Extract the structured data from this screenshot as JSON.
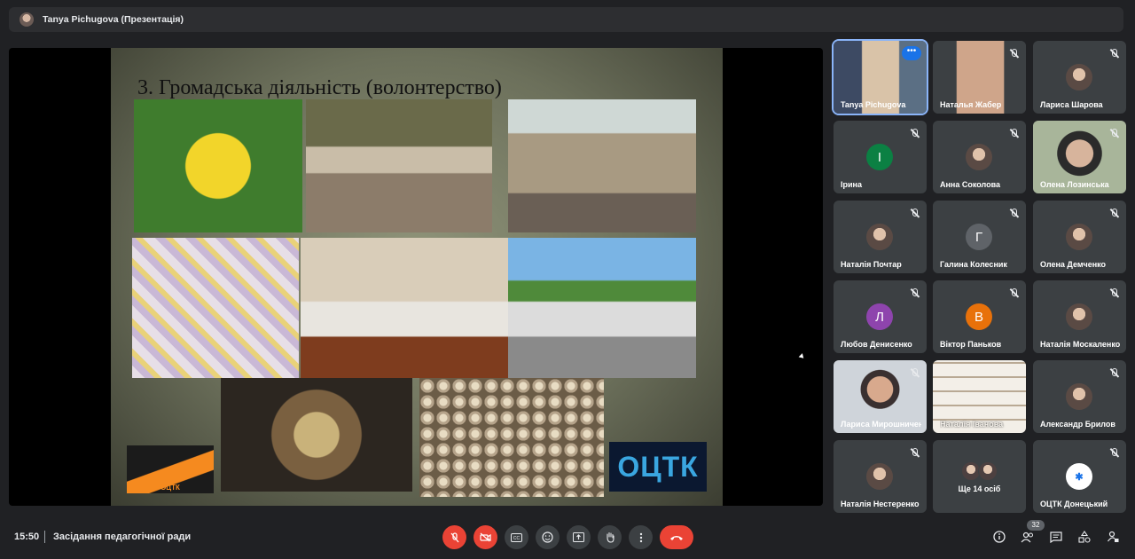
{
  "topbar": {
    "title": "Tanya Pichugova (Презентація)"
  },
  "slide": {
    "title": "3. Громадська діяльність (волонтерство)",
    "logo_left_text": "ОЦТК",
    "logo_right_text": "ОЦТК"
  },
  "participants": [
    {
      "name": "Tanya Pichugova",
      "type": "video"
    },
    {
      "name": "Наталья Жабер",
      "type": "video"
    },
    {
      "name": "Лариса Шарова",
      "type": "photo"
    },
    {
      "name": "Ірина",
      "type": "letter",
      "letter": "І",
      "color": "#0b8043"
    },
    {
      "name": "Анна Соколова",
      "type": "photo"
    },
    {
      "name": "Олена Лозинська",
      "type": "video"
    },
    {
      "name": "Наталія Почтар",
      "type": "photo"
    },
    {
      "name": "Галина Колесник",
      "type": "letter",
      "letter": "Г",
      "color": "#5f6368"
    },
    {
      "name": "Олена Демченко",
      "type": "photo"
    },
    {
      "name": "Любов Денисенко",
      "type": "letter",
      "letter": "Л",
      "color": "#8e44ad"
    },
    {
      "name": "Віктор Паньков",
      "type": "letter",
      "letter": "В",
      "color": "#e8710a"
    },
    {
      "name": "Наталія Москаленко",
      "type": "photo"
    },
    {
      "name": "Лариса Мирошниченко",
      "type": "video"
    },
    {
      "name": "Наталія Іванова",
      "type": "video"
    },
    {
      "name": "Александр Брилов",
      "type": "photo"
    },
    {
      "name": "Наталія Нестеренко",
      "type": "photo"
    },
    {
      "name": "Ще 14 осіб",
      "type": "group"
    },
    {
      "name": "ОЦТК Донецький",
      "type": "logo"
    }
  ],
  "bottombar": {
    "time": "15:50",
    "meeting_name": "Засідання педагогічної ради",
    "participant_count": "32",
    "accent_red": "#ea4335"
  }
}
